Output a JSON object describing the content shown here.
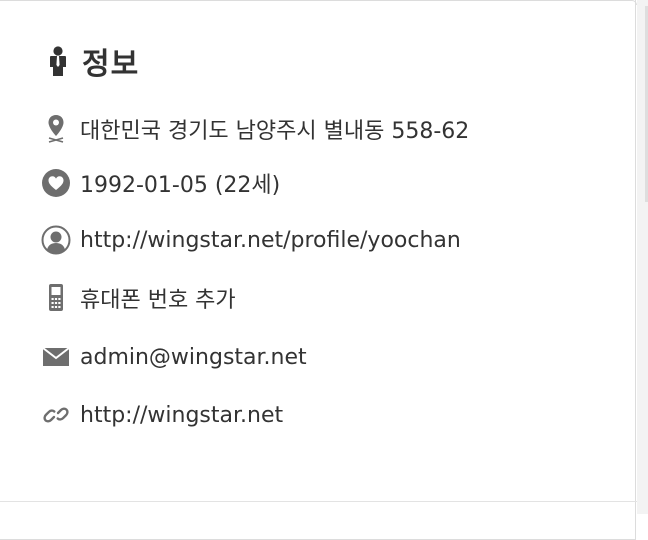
{
  "section": {
    "title": "정보",
    "icon": "person-icon"
  },
  "info_items": [
    {
      "icon": "location-pin-icon",
      "text": "대한민국 경기도 남양주시 별내동 558-62"
    },
    {
      "icon": "heart-icon",
      "text": "1992-01-05 (22세)"
    },
    {
      "icon": "profile-user-icon",
      "text": "http://wingstar.net/profile/yoochan"
    },
    {
      "icon": "mobile-phone-icon",
      "text": "휴대폰 번호 추가"
    },
    {
      "icon": "envelope-icon",
      "text": "admin@wingstar.net"
    },
    {
      "icon": "link-icon",
      "text": "http://wingstar.net"
    }
  ],
  "colors": {
    "text": "#333333",
    "icon": "#6e6e6e",
    "border": "#dcdcdc"
  }
}
